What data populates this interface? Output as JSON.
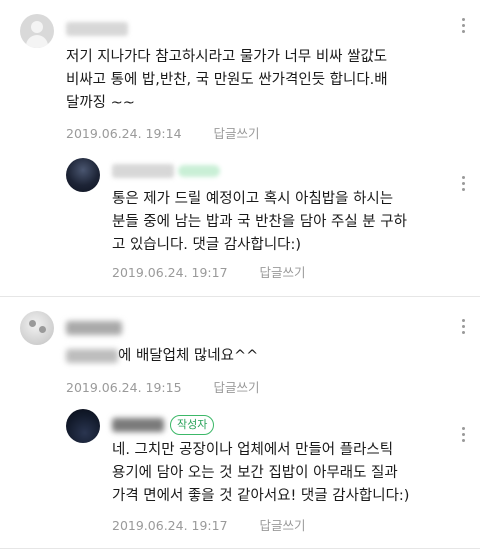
{
  "comments": [
    {
      "text": "저기 지나가다 참고하시라고 물가가 너무 비싸 쌀값도\n비싸고 통에 밥,반찬, 국 만원도 싼가격인듯 합니다.배\n달까징 ~~",
      "date": "2019.06.24. 19:14",
      "reply_label": "답글쓰기"
    },
    {
      "text": "통은 제가 드릴 예정이고 혹시 아침밥을 하시는\n분들 중에 남는 밥과 국 반찬을 담아 주실 분 구하\n고 있습니다. 댓글 감사합니다:)",
      "date": "2019.06.24. 19:17",
      "reply_label": "답글쓰기"
    },
    {
      "text": "에 배달업체 많네요^^",
      "date": "2019.06.24. 19:15",
      "reply_label": "답글쓰기"
    },
    {
      "author_badge": "작성자",
      "text": "네. 그치만 공장이나 업체에서 만들어 플라스틱\n용기에 담아 오는 것 보간 집밥이 아무래도 질과\n가격 면에서 좋을 것 같아서요! 댓글 감사합니다:)",
      "date": "2019.06.24. 19:17",
      "reply_label": "답글쓰기"
    }
  ],
  "icons": {
    "more": "vertical-ellipsis-icon",
    "avatar_default": "default-avatar-icon"
  },
  "colors": {
    "author_badge": "#2aa35a",
    "meta": "#9a9a9a",
    "divider": "#e6e6e6"
  }
}
